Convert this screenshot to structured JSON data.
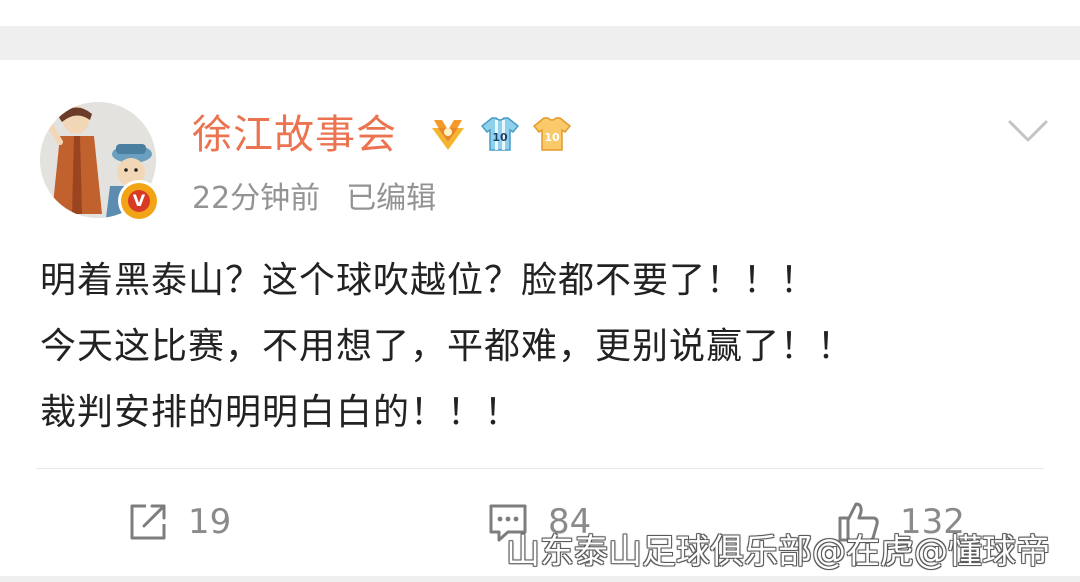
{
  "post": {
    "username": "徐江故事会",
    "time": "22分钟前",
    "edited": "已编辑",
    "verified_mark": "V",
    "lines": [
      "明着黑泰山？这个球吹越位？脸都不要了！！！",
      "今天这比赛，不用想了，平都难，更别说赢了！！",
      "裁判安排的明明白白的！！！"
    ]
  },
  "actions": {
    "repost_count": "19",
    "comment_count": "84",
    "like_count": "132"
  },
  "watermark": "山东泰山足球俱乐部@在虎@懂球帝",
  "icons": {
    "avatar": "cartoon-avatar",
    "verified": "verified-badge-icon",
    "badges": [
      "gold-medal-icon",
      "jersey-10-blue-icon",
      "jersey-10-gold-icon"
    ],
    "menu": "chevron-down-icon",
    "repost": "share-icon",
    "comment": "comment-icon",
    "like": "thumbs-up-icon"
  },
  "colors": {
    "username": "#eb7350",
    "meta": "#939393",
    "text": "#222222",
    "band": "#efefef"
  }
}
